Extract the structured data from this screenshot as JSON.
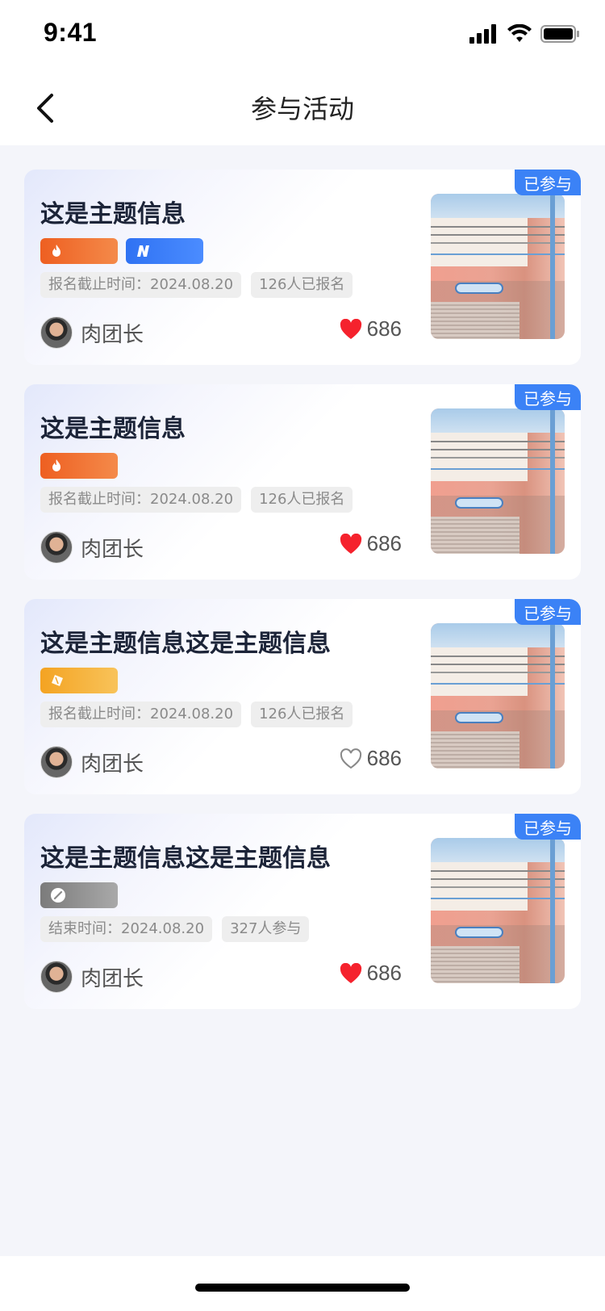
{
  "status_bar": {
    "time": "9:41"
  },
  "nav": {
    "title": "参与活动"
  },
  "cards": [
    {
      "title": "这是主题信息",
      "tags": [
        "hot",
        "new"
      ],
      "meta": [
        "报名截止时间：2024.08.20",
        "126人已报名"
      ],
      "author": "肉团长",
      "likes": "686",
      "liked": true,
      "badge": "已参与"
    },
    {
      "title": "这是主题信息",
      "tags": [
        "hot"
      ],
      "meta": [
        "报名截止时间：2024.08.20",
        "126人已报名"
      ],
      "author": "肉团长",
      "likes": "686",
      "liked": true,
      "badge": "已参与"
    },
    {
      "title": "这是主题信息这是主题信息",
      "tags": [
        "sale"
      ],
      "meta": [
        "报名截止时间：2024.08.20",
        "126人已报名"
      ],
      "author": "肉团长",
      "likes": "686",
      "liked": false,
      "badge": "已参与"
    },
    {
      "title": "这是主题信息这是主题信息",
      "tags": [
        "ended"
      ],
      "meta": [
        "结束时间：2024.08.20",
        "327人参与"
      ],
      "author": "肉团长",
      "likes": "686",
      "liked": true,
      "badge": "已参与"
    }
  ],
  "icons": {
    "back": "chevron-left-icon",
    "like_filled": "heart-filled-icon",
    "like_empty": "heart-outline-icon"
  },
  "colors": {
    "accent_blue": "#3b82f6",
    "heart_red": "#f5222d",
    "tag_hot": "#ee5f21",
    "tag_new": "#2f72f3",
    "tag_sale": "#f4a322",
    "tag_end": "#8a8a8a"
  }
}
